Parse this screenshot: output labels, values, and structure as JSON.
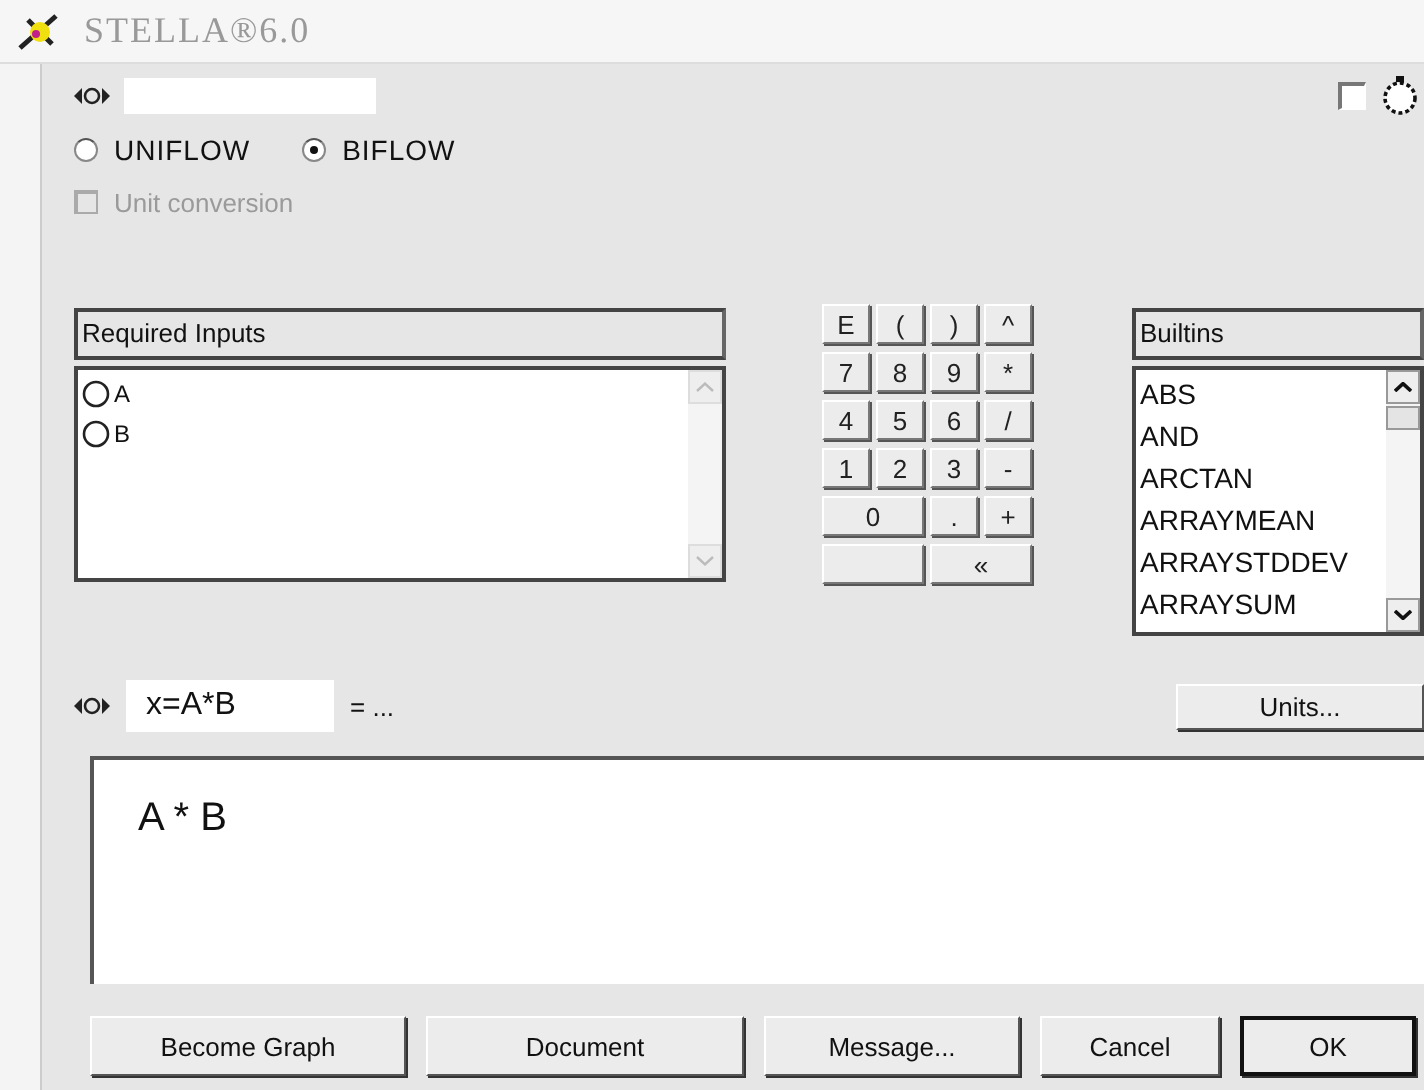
{
  "window": {
    "title": "STELLA®6.0"
  },
  "top_checkbox": {
    "checked": false
  },
  "flow_options": [
    {
      "label": "UNIFLOW",
      "selected": false
    },
    {
      "label": "BIFLOW",
      "selected": true
    }
  ],
  "unit_conversion": {
    "label": "Unit conversion",
    "checked": false,
    "disabled": true
  },
  "required_inputs": {
    "title": "Required Inputs",
    "items": [
      {
        "label": "A"
      },
      {
        "label": "B"
      }
    ]
  },
  "keypad": [
    [
      {
        "kind": "key",
        "label": "E"
      },
      {
        "kind": "key",
        "label": "("
      },
      {
        "kind": "key",
        "label": ")"
      },
      {
        "kind": "key",
        "label": "^"
      }
    ],
    [
      {
        "kind": "key",
        "label": "7"
      },
      {
        "kind": "key",
        "label": "8"
      },
      {
        "kind": "key",
        "label": "9"
      },
      {
        "kind": "key",
        "label": "*"
      }
    ],
    [
      {
        "kind": "key",
        "label": "4"
      },
      {
        "kind": "key",
        "label": "5"
      },
      {
        "kind": "key",
        "label": "6"
      },
      {
        "kind": "key",
        "label": "/"
      }
    ],
    [
      {
        "kind": "key",
        "label": "1"
      },
      {
        "kind": "key",
        "label": "2"
      },
      {
        "kind": "key",
        "label": "3"
      },
      {
        "kind": "key",
        "label": "-"
      }
    ],
    [
      {
        "kind": "wide-key",
        "label": "0"
      },
      {
        "kind": "key",
        "label": "."
      },
      {
        "kind": "key",
        "label": "+"
      }
    ],
    [
      {
        "kind": "blank-wide-key"
      },
      {
        "kind": "wide-key",
        "label": "«"
      }
    ]
  ],
  "builtins": {
    "title": "Builtins",
    "items": [
      {
        "label": "ABS"
      },
      {
        "label": "AND"
      },
      {
        "label": "ARCTAN"
      },
      {
        "label": "ARRAYMEAN"
      },
      {
        "label": "ARRAYSTDDEV"
      },
      {
        "label": "ARRAYSUM"
      }
    ]
  },
  "equation": {
    "variable": "x=A*B",
    "suffix": "= ...",
    "units_button": "Units...",
    "text": "A * B"
  },
  "buttons": [
    {
      "label": "Become Graph",
      "default": false
    },
    {
      "label": "Document",
      "default": false
    },
    {
      "label": "Message...",
      "default": false
    },
    {
      "label": "Cancel",
      "default": false
    },
    {
      "label": "OK",
      "default": true
    }
  ]
}
